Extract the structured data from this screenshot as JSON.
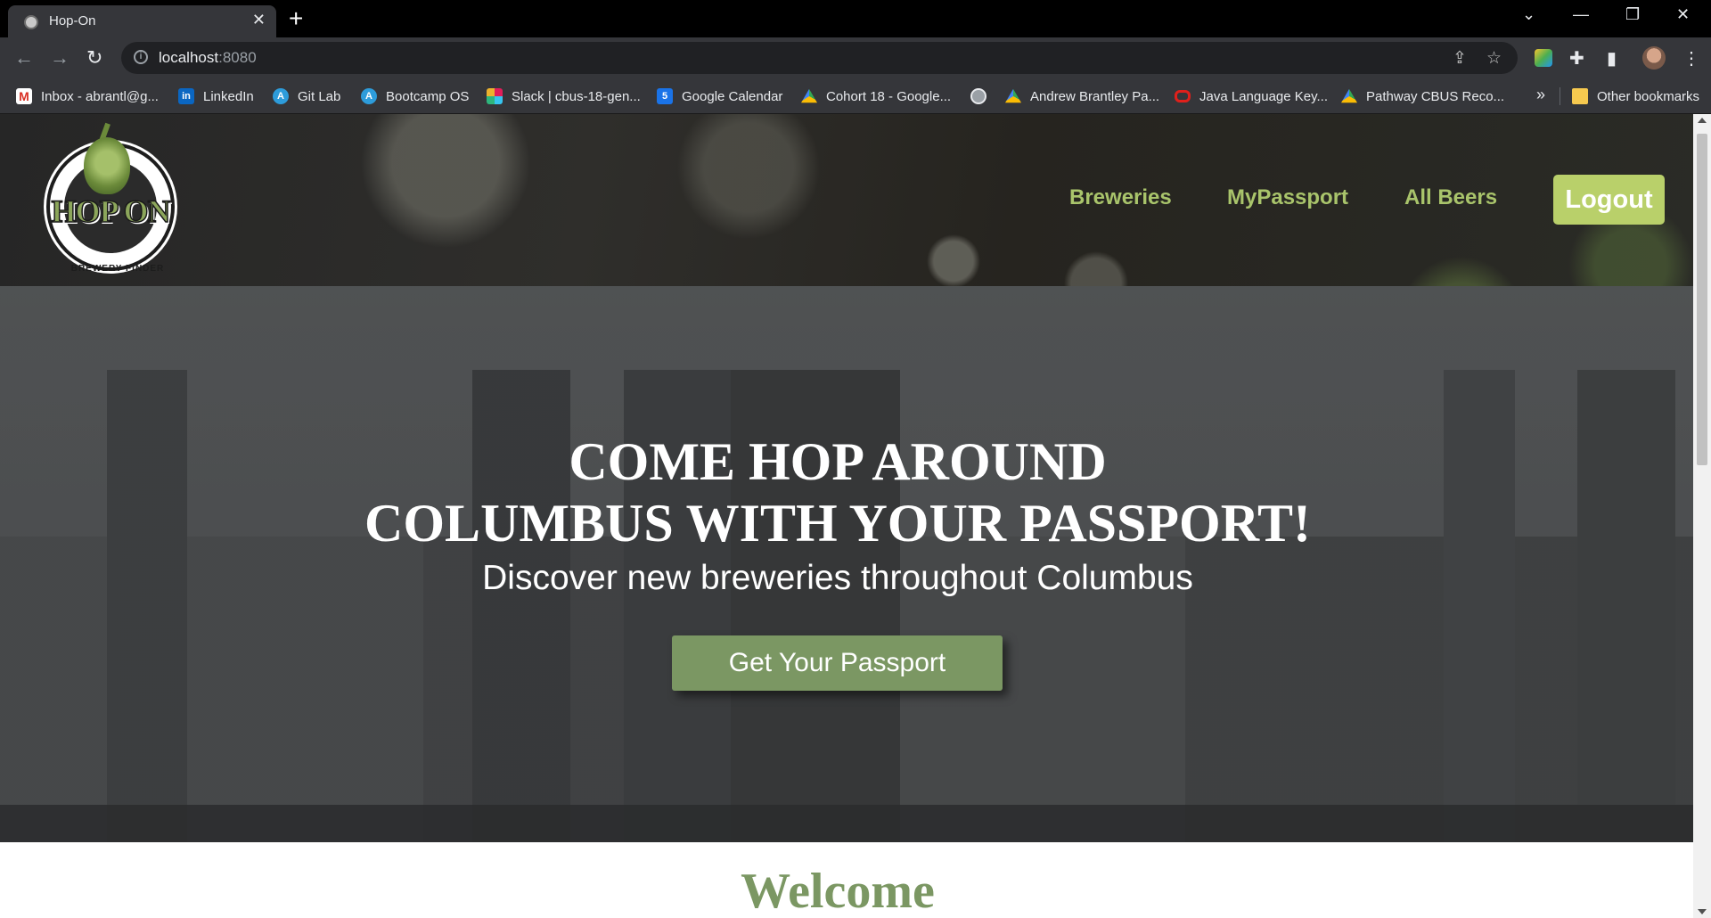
{
  "browser": {
    "tab_title": "Hop-On",
    "url_host": "localhost",
    "url_port": ":8080",
    "bookmarks": [
      {
        "label": "Inbox - abrantl@g...",
        "icon": "gmail-icon"
      },
      {
        "label": "LinkedIn",
        "icon": "linkedin-icon"
      },
      {
        "label": "Git Lab",
        "icon": "gitlab-icon"
      },
      {
        "label": "Bootcamp OS",
        "icon": "bootcamp-icon"
      },
      {
        "label": "Slack | cbus-18-gen...",
        "icon": "slack-icon"
      },
      {
        "label": "Google Calendar",
        "icon": "calendar-icon"
      },
      {
        "label": "Cohort 18 - Google...",
        "icon": "google-drive-icon"
      },
      {
        "label": "",
        "icon": "globe-icon"
      },
      {
        "label": "Andrew Brantley Pa...",
        "icon": "google-drive-icon"
      },
      {
        "label": "Java Language Key...",
        "icon": "oracle-icon"
      },
      {
        "label": "Pathway CBUS Reco...",
        "icon": "google-drive-icon"
      }
    ],
    "bookmarks_more": "»",
    "other_bookmarks": "Other bookmarks"
  },
  "site": {
    "logo_word": "HOP ON",
    "logo_tagline": "BREWERY FINDER",
    "nav": {
      "breweries": "Breweries",
      "mypassport": "MyPassport",
      "allbeers": "All Beers",
      "logout": "Logout"
    },
    "hero": {
      "headline_line1": "COME HOP AROUND",
      "headline_line2": "COLUMBUS WITH YOUR PASSPORT!",
      "subheadline": "Discover new breweries throughout Columbus",
      "cta": "Get Your Passport"
    },
    "welcome": "Welcome"
  },
  "colors": {
    "brand_green": "#a9c46b",
    "button_lime": "#b9d06a",
    "cta_green": "#7b9763"
  }
}
